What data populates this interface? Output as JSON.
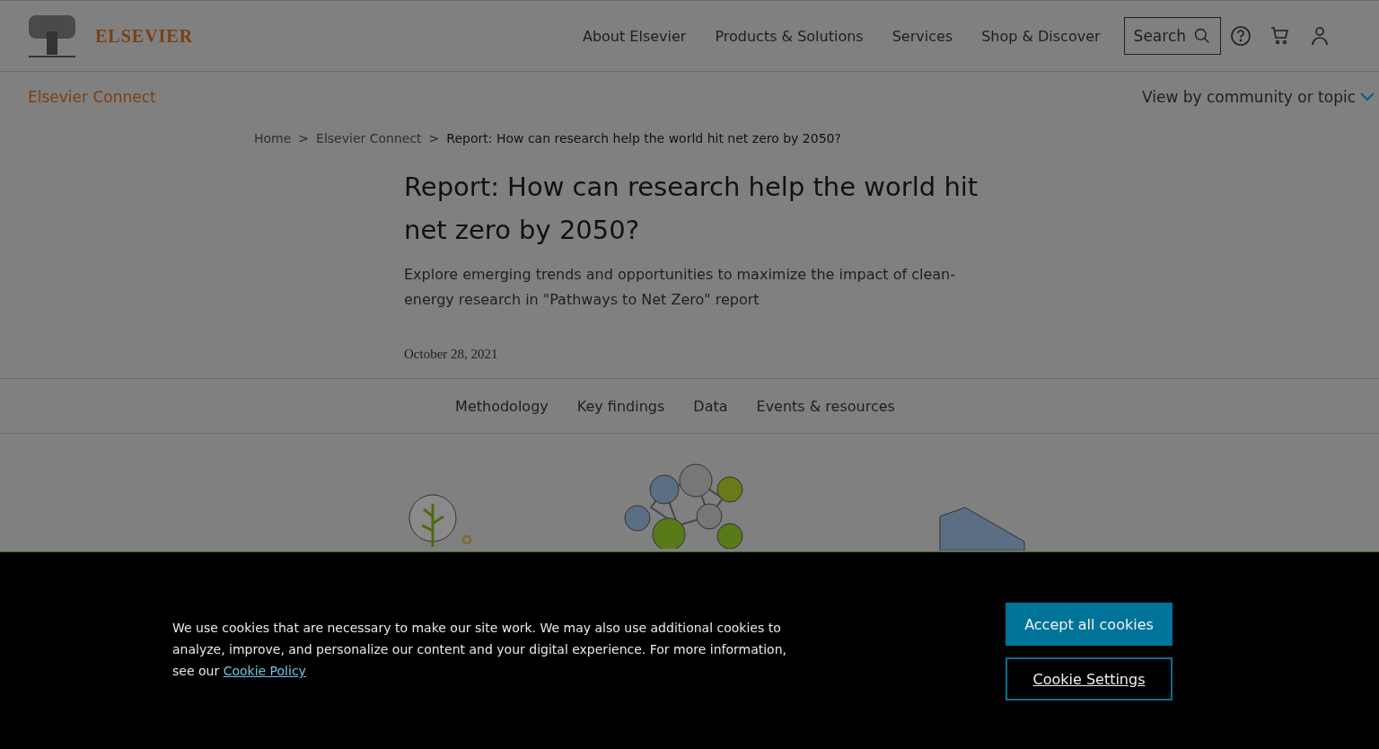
{
  "header": {
    "brand": "ELSEVIER",
    "nav": [
      "About Elsevier",
      "Products & Solutions",
      "Services",
      "Shop & Discover"
    ],
    "search": {
      "label": "Search"
    }
  },
  "subnav": {
    "title": "Elsevier Connect",
    "menu": "View by community or topic"
  },
  "breadcrumb_separator": ">",
  "breadcrumb": [
    "Home",
    "Elsevier Connect",
    "Report: How can research help the world hit net zero by 2050?"
  ],
  "article": {
    "title": "Report: How can research help the world hit net zero by 2050?",
    "subtitle": "Explore emerging trends and opportunities to maximize the impact of clean-energy research in \"Pathways to Net Zero\" report",
    "date": "October 28, 2021"
  },
  "tabs": [
    "Methodology",
    "Key findings",
    "Data",
    "Events & resources"
  ],
  "cookie_banner": {
    "text": "We use cookies that are necessary to make our site work. We may also use additional cookies to analyze, improve, and personalize our content and your digital experience. For more information, see our ",
    "link": "Cookie Policy",
    "buttons": [
      {
        "label": "Accept all cookies",
        "kind": "primary"
      },
      {
        "label": "Cookie Settings",
        "kind": "outline"
      }
    ]
  }
}
